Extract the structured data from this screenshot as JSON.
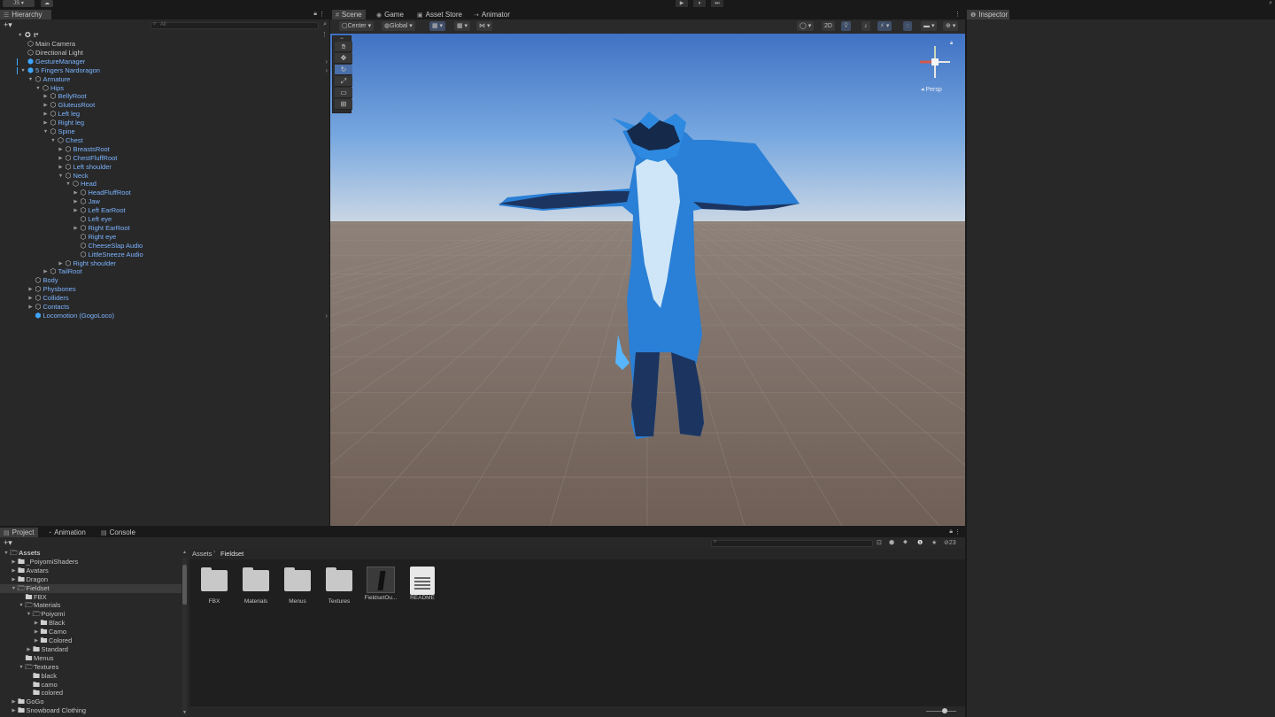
{
  "toolbar": {
    "account_label": "JS",
    "cloud_label": "☁",
    "play": "▶",
    "pause": "⏸",
    "step": "⏭"
  },
  "hierarchy": {
    "tab": "Hierarchy",
    "search_placeholder": "All",
    "scene_root": "t*",
    "items": [
      {
        "label": "Main Camera",
        "depth": 1,
        "icon": "gameobject",
        "arrow": ""
      },
      {
        "label": "Directional Light",
        "depth": 1,
        "icon": "gameobject",
        "arrow": ""
      },
      {
        "label": "GestureManager",
        "depth": 1,
        "icon": "prefab",
        "arrow": "",
        "blue": true,
        "chev": true
      },
      {
        "label": "5 Fingers Nardoragon",
        "depth": 1,
        "icon": "prefab",
        "arrow": "▼",
        "blue": true,
        "chev": true
      },
      {
        "label": "Armature",
        "depth": 2,
        "icon": "gameobject",
        "arrow": "▼",
        "blue": true
      },
      {
        "label": "Hips",
        "depth": 3,
        "icon": "gameobject",
        "arrow": "▼",
        "blue": true
      },
      {
        "label": "BellyRoot",
        "depth": 4,
        "icon": "gameobject",
        "arrow": "▶",
        "blue": true
      },
      {
        "label": "GluteusRoot",
        "depth": 4,
        "icon": "gameobject",
        "arrow": "▶",
        "blue": true
      },
      {
        "label": "Left leg",
        "depth": 4,
        "icon": "gameobject",
        "arrow": "▶",
        "blue": true
      },
      {
        "label": "Right leg",
        "depth": 4,
        "icon": "gameobject",
        "arrow": "▶",
        "blue": true
      },
      {
        "label": "Spine",
        "depth": 4,
        "icon": "gameobject",
        "arrow": "▼",
        "blue": true
      },
      {
        "label": "Chest",
        "depth": 5,
        "icon": "gameobject",
        "arrow": "▼",
        "blue": true
      },
      {
        "label": "BreastsRoot",
        "depth": 6,
        "icon": "gameobject",
        "arrow": "▶",
        "blue": true
      },
      {
        "label": "ChestFluffRoot",
        "depth": 6,
        "icon": "gameobject",
        "arrow": "▶",
        "blue": true
      },
      {
        "label": "Left shoulder",
        "depth": 6,
        "icon": "gameobject",
        "arrow": "▶",
        "blue": true
      },
      {
        "label": "Neck",
        "depth": 6,
        "icon": "gameobject",
        "arrow": "▼",
        "blue": true
      },
      {
        "label": "Head",
        "depth": 7,
        "icon": "gameobject",
        "arrow": "▼",
        "blue": true
      },
      {
        "label": "HeadFluffRoot",
        "depth": 8,
        "icon": "gameobject",
        "arrow": "▶",
        "blue": true
      },
      {
        "label": "Jaw",
        "depth": 8,
        "icon": "gameobject",
        "arrow": "▶",
        "blue": true
      },
      {
        "label": "Left EarRoot",
        "depth": 8,
        "icon": "gameobject",
        "arrow": "▶",
        "blue": true
      },
      {
        "label": "Left eye",
        "depth": 8,
        "icon": "gameobject",
        "arrow": "",
        "blue": true
      },
      {
        "label": "Right EarRoot",
        "depth": 8,
        "icon": "gameobject",
        "arrow": "▶",
        "blue": true
      },
      {
        "label": "Right eye",
        "depth": 8,
        "icon": "gameobject",
        "arrow": "",
        "blue": true
      },
      {
        "label": "CheeseSlap Audio",
        "depth": 8,
        "icon": "gameobject",
        "arrow": "",
        "blue": true
      },
      {
        "label": "LittleSneeze Audio",
        "depth": 8,
        "icon": "gameobject",
        "arrow": "",
        "blue": true
      },
      {
        "label": "Right shoulder",
        "depth": 6,
        "icon": "gameobject",
        "arrow": "▶",
        "blue": true
      },
      {
        "label": "TailRoot",
        "depth": 4,
        "icon": "gameobject",
        "arrow": "▶",
        "blue": true
      },
      {
        "label": "Body",
        "depth": 2,
        "icon": "gameobject",
        "arrow": "",
        "blue": true
      },
      {
        "label": "Physbones",
        "depth": 2,
        "icon": "gameobject",
        "arrow": "▶",
        "blue": true
      },
      {
        "label": "Colliders",
        "depth": 2,
        "icon": "gameobject",
        "arrow": "▶",
        "blue": true
      },
      {
        "label": "Contacts",
        "depth": 2,
        "icon": "gameobject",
        "arrow": "▶",
        "blue": true
      },
      {
        "label": "Locomotion (GogoLoco)",
        "depth": 2,
        "icon": "prefab",
        "arrow": "",
        "blue": true,
        "chev": true
      }
    ]
  },
  "scene": {
    "tabs": [
      {
        "label": "Scene",
        "icon": "#",
        "active": true
      },
      {
        "label": "Game",
        "icon": "◉"
      },
      {
        "label": "Asset Store",
        "icon": "▣"
      },
      {
        "label": "Animator",
        "icon": "⇢"
      }
    ],
    "pivot_label": "Center",
    "space_label": "Global",
    "mode_2d": "2D",
    "persp_label": "Persp"
  },
  "inspector": {
    "tab": "Inspector"
  },
  "project": {
    "tabs": [
      {
        "label": "Project",
        "icon": "▤",
        "active": true
      },
      {
        "label": "Animation",
        "icon": "◔"
      },
      {
        "label": "Console",
        "icon": "▤"
      }
    ],
    "breadcrumb": [
      "Assets",
      "Fieldset"
    ],
    "hidden_count": "23",
    "tree": [
      {
        "label": "Assets",
        "depth": 0,
        "arrow": "▼",
        "open": true,
        "bold": true
      },
      {
        "label": "_PoiyomiShaders",
        "depth": 1,
        "arrow": "▶"
      },
      {
        "label": "Avatars",
        "depth": 1,
        "arrow": "▶"
      },
      {
        "label": "Dragon",
        "depth": 1,
        "arrow": "▶"
      },
      {
        "label": "Fieldset",
        "depth": 1,
        "arrow": "▼",
        "open": true,
        "selected": true
      },
      {
        "label": "FBX",
        "depth": 2,
        "arrow": ""
      },
      {
        "label": "Materials",
        "depth": 2,
        "arrow": "▼",
        "open": true
      },
      {
        "label": "Poiyomi",
        "depth": 3,
        "arrow": "▼",
        "open": true
      },
      {
        "label": "Black",
        "depth": 4,
        "arrow": "▶"
      },
      {
        "label": "Camo",
        "depth": 4,
        "arrow": "▶"
      },
      {
        "label": "Colored",
        "depth": 4,
        "arrow": "▶"
      },
      {
        "label": "Standard",
        "depth": 3,
        "arrow": "▶"
      },
      {
        "label": "Menus",
        "depth": 2,
        "arrow": ""
      },
      {
        "label": "Textures",
        "depth": 2,
        "arrow": "▼",
        "open": true
      },
      {
        "label": "black",
        "depth": 3,
        "arrow": ""
      },
      {
        "label": "camo",
        "depth": 3,
        "arrow": ""
      },
      {
        "label": "colored",
        "depth": 3,
        "arrow": ""
      },
      {
        "label": "GoGo",
        "depth": 1,
        "arrow": "▶"
      },
      {
        "label": "Snowboard Clothing",
        "depth": 1,
        "arrow": "▶"
      }
    ],
    "assets": [
      {
        "label": "FBX",
        "type": "folder"
      },
      {
        "label": "Materials",
        "type": "folder"
      },
      {
        "label": "Menus",
        "type": "folder"
      },
      {
        "label": "Textures",
        "type": "folder"
      },
      {
        "label": "FieldsetOu...",
        "type": "prefab"
      },
      {
        "label": "README",
        "type": "text"
      }
    ]
  }
}
